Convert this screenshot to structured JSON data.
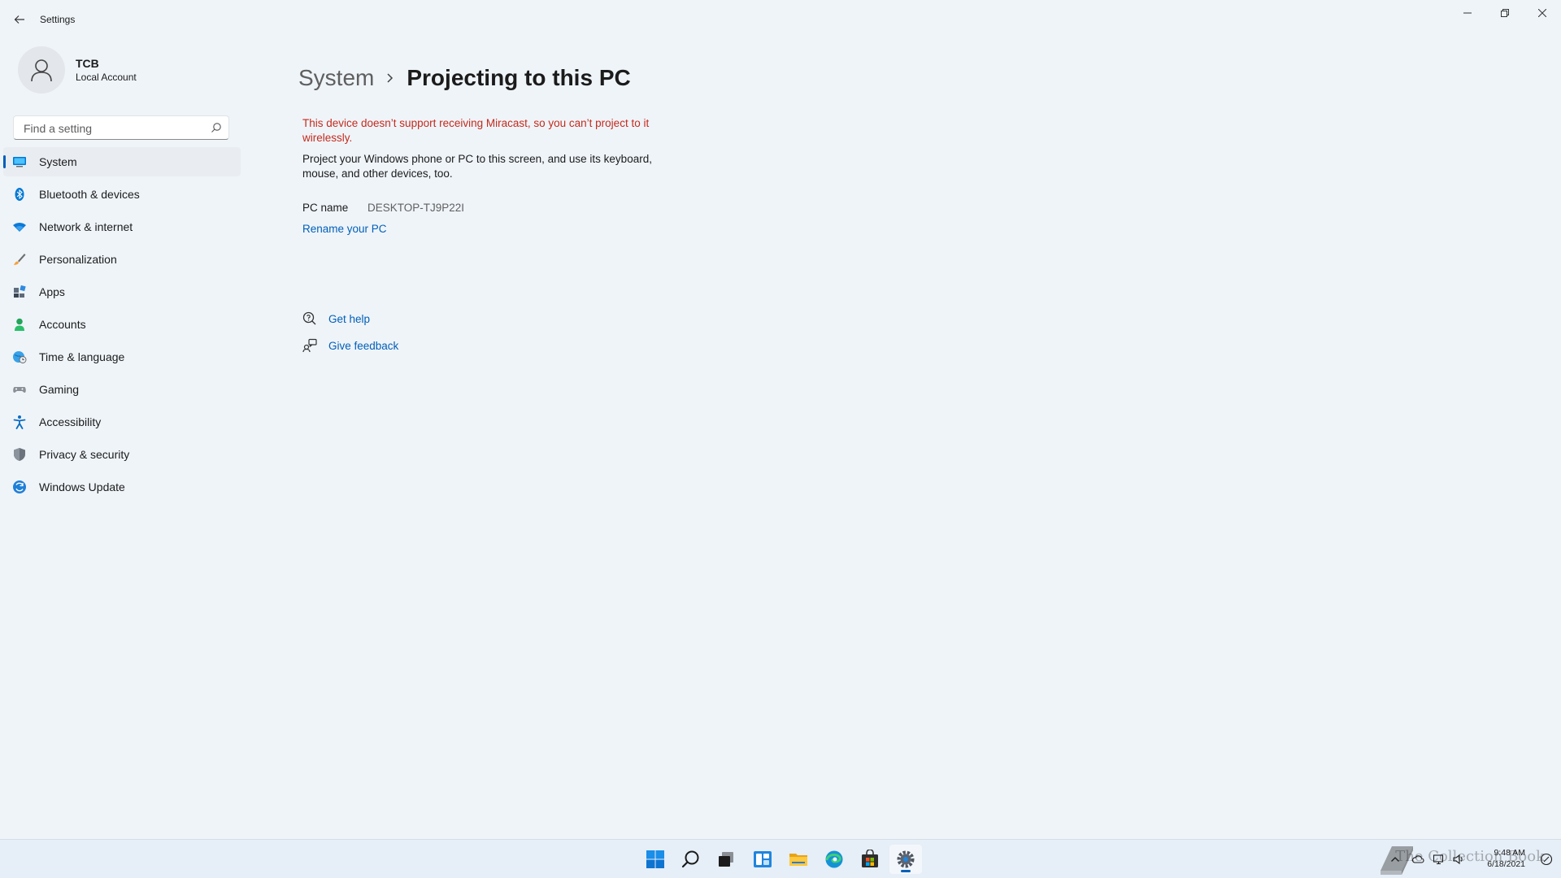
{
  "window": {
    "app_title": "Settings",
    "minimize_icon": "minimize-icon",
    "restore_icon": "restore-icon",
    "close_icon": "close-icon"
  },
  "profile": {
    "name": "TCB",
    "account_type": "Local Account"
  },
  "search": {
    "placeholder": "Find a setting",
    "value": ""
  },
  "nav": {
    "items": [
      {
        "label": "System",
        "icon": "system-icon",
        "active": true
      },
      {
        "label": "Bluetooth & devices",
        "icon": "bluetooth-icon"
      },
      {
        "label": "Network & internet",
        "icon": "wifi-icon"
      },
      {
        "label": "Personalization",
        "icon": "brush-icon"
      },
      {
        "label": "Apps",
        "icon": "apps-icon"
      },
      {
        "label": "Accounts",
        "icon": "person-icon"
      },
      {
        "label": "Time & language",
        "icon": "globe-clock-icon"
      },
      {
        "label": "Gaming",
        "icon": "gamepad-icon"
      },
      {
        "label": "Accessibility",
        "icon": "accessibility-icon"
      },
      {
        "label": "Privacy & security",
        "icon": "shield-icon"
      },
      {
        "label": "Windows Update",
        "icon": "update-icon"
      }
    ]
  },
  "main": {
    "breadcrumb_parent": "System",
    "breadcrumb_current": "Projecting to this PC",
    "warning": "This device doesn’t support receiving Miracast, so you can’t project to it wirelessly.",
    "description": "Project your Windows phone or PC to this screen, and use its keyboard, mouse, and other devices, too.",
    "pc_name_label": "PC name",
    "pc_name_value": "DESKTOP-TJ9P22I",
    "rename_link": "Rename your PC",
    "get_help": "Get help",
    "give_feedback": "Give feedback"
  },
  "taskbar": {
    "apps": [
      "start-icon",
      "search-icon",
      "task-view-icon",
      "widgets-icon",
      "file-explorer-icon",
      "edge-icon",
      "store-icon",
      "settings-icon"
    ],
    "clock_time": "9:48 AM",
    "clock_date": "6/18/2021",
    "watermark": "The Collection Book"
  },
  "colors": {
    "accent": "#005fb8",
    "warning": "#c42b1c",
    "background": "#eff4f9"
  }
}
